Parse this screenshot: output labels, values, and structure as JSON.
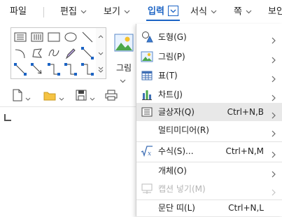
{
  "menubar": {
    "tabs": [
      {
        "label": "파일"
      },
      {
        "label": "편집"
      },
      {
        "label": "보기"
      },
      {
        "label": "입력"
      },
      {
        "label": "서식"
      },
      {
        "label": "쪽"
      },
      {
        "label": "보안"
      }
    ],
    "active_tab": "입력",
    "accent_color": "#1b63c4"
  },
  "ribbon": {
    "picture_label": "그림"
  },
  "insert_menu": {
    "items": [
      {
        "label": "도형(G)",
        "icon": "shape-icon",
        "submenu": true
      },
      {
        "label": "그림(P)",
        "icon": "picture-icon",
        "submenu": true
      },
      {
        "label": "표(T)",
        "icon": "table-icon",
        "submenu": true
      },
      {
        "label": "차트(J)",
        "icon": "chart-icon",
        "submenu": true
      },
      {
        "label": "글상자(Q)",
        "icon": "textbox-icon",
        "shortcut": "Ctrl+N,B",
        "submenu": true,
        "highlighted": true
      },
      {
        "label": "멀티미디어(R)",
        "submenu": true
      },
      {
        "label": "수식(S)...",
        "icon": "formula-icon",
        "shortcut": "Ctrl+N,M",
        "submenu": true
      },
      {
        "label": "개체(O)",
        "submenu": true
      },
      {
        "label": "캡션 넣기(M)",
        "icon": "caption-icon",
        "submenu": true,
        "disabled": true
      },
      {
        "label": "문단 띠(L)",
        "shortcut": "Ctrl+N,L"
      }
    ]
  }
}
